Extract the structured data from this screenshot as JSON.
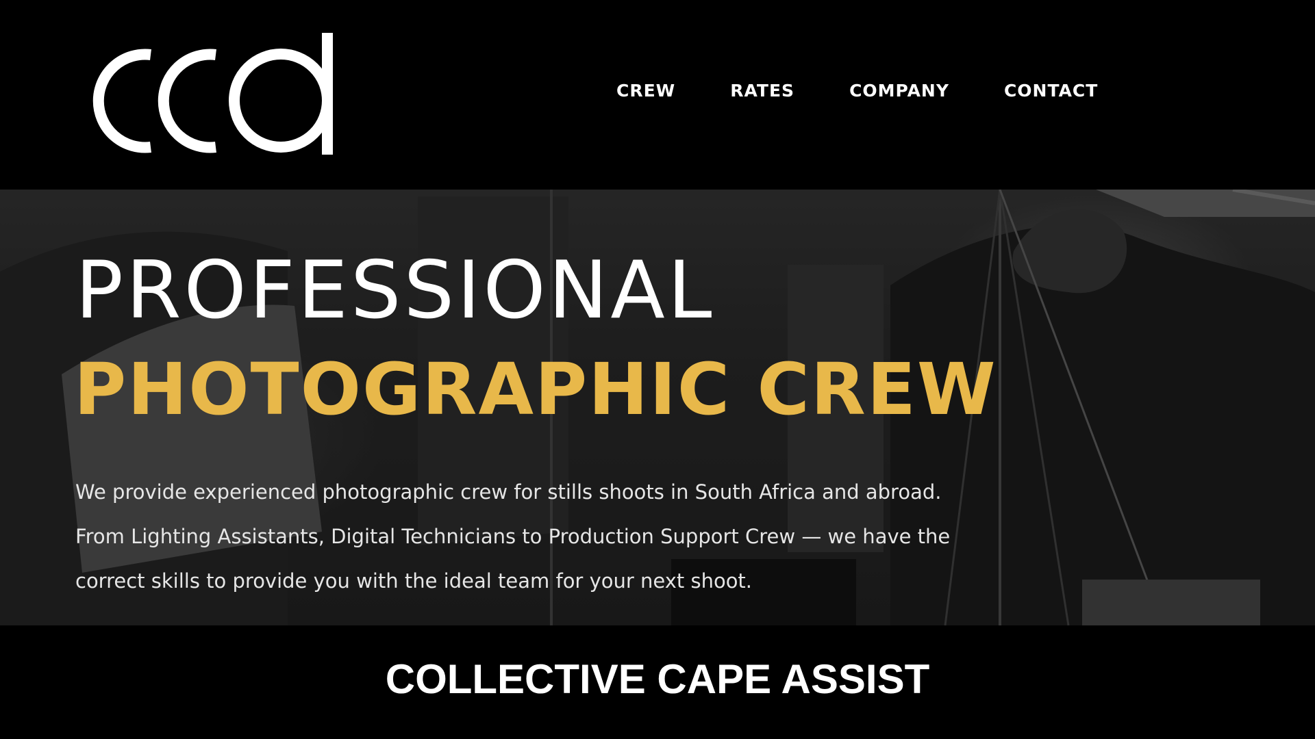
{
  "logo": {
    "alt": "cca",
    "color": "#ffffff",
    "icon": "cca-logo-icon"
  },
  "nav": {
    "items": [
      {
        "label": "CREW"
      },
      {
        "label": "RATES"
      },
      {
        "label": "COMPANY"
      },
      {
        "label": "CONTACT"
      }
    ]
  },
  "hero": {
    "headline_line1": "PROFESSIONAL",
    "headline_line2": "PHOTOGRAPHIC CREW",
    "intro_lines": [
      "We provide experienced photographic crew for stills shoots in South Africa and abroad.",
      "From Lighting Assistants, Digital Technicians to Production Support Crew — we have the",
      "correct skills to provide you with the ideal team for your next shoot."
    ]
  },
  "caption": "COLLECTIVE CAPE ASSIST",
  "colors": {
    "background": "#000000",
    "accent": "#e8b84a",
    "text": "#ffffff"
  }
}
